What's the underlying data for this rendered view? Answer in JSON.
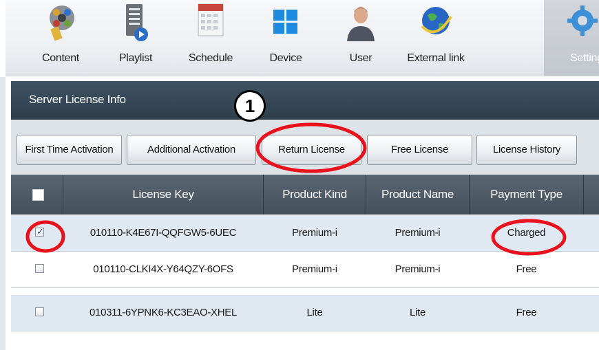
{
  "nav": {
    "items": [
      {
        "label": "Content",
        "icon": "content-film-reel-icon"
      },
      {
        "label": "Playlist",
        "icon": "playlist-document-icon"
      },
      {
        "label": "Schedule",
        "icon": "schedule-calendar-icon"
      },
      {
        "label": "Device",
        "icon": "device-windows-icon"
      },
      {
        "label": "User",
        "icon": "user-person-icon"
      },
      {
        "label": "External link",
        "icon": "external-link-globe-icon"
      },
      {
        "label": "Settings",
        "icon": "settings-gear-icon"
      }
    ],
    "active": "Settings"
  },
  "section": {
    "title": "Server License Info"
  },
  "tabs": [
    {
      "label": "First Time Activation"
    },
    {
      "label": "Additional Activation"
    },
    {
      "label": "Return License"
    },
    {
      "label": "Free License"
    },
    {
      "label": "License History"
    }
  ],
  "table": {
    "columns": [
      "License Key",
      "Product Kind",
      "Product Name",
      "Payment Type"
    ],
    "rows": [
      {
        "checked": true,
        "license_key": "010110-K4E67I-QQFGW5-6UEC",
        "product_kind": "Premium-i",
        "product_name": "Premium-i",
        "payment_type": "Charged"
      },
      {
        "checked": false,
        "license_key": "010110-CLKI4X-Y64QZY-6OFS",
        "product_kind": "Premium-i",
        "product_name": "Premium-i",
        "payment_type": "Free"
      },
      {
        "checked": false,
        "license_key": "010311-6YPNK6-KC3EAO-XHEL",
        "product_kind": "Lite",
        "product_name": "Lite",
        "payment_type": "Free"
      }
    ]
  },
  "annotation": {
    "step": "1",
    "color": "#e8111c"
  },
  "colors": {
    "header": "#2d3d4b",
    "table_header": "#4e5a65",
    "selected_row": "#e0e8f1",
    "accent_annotation": "#e8111c"
  }
}
